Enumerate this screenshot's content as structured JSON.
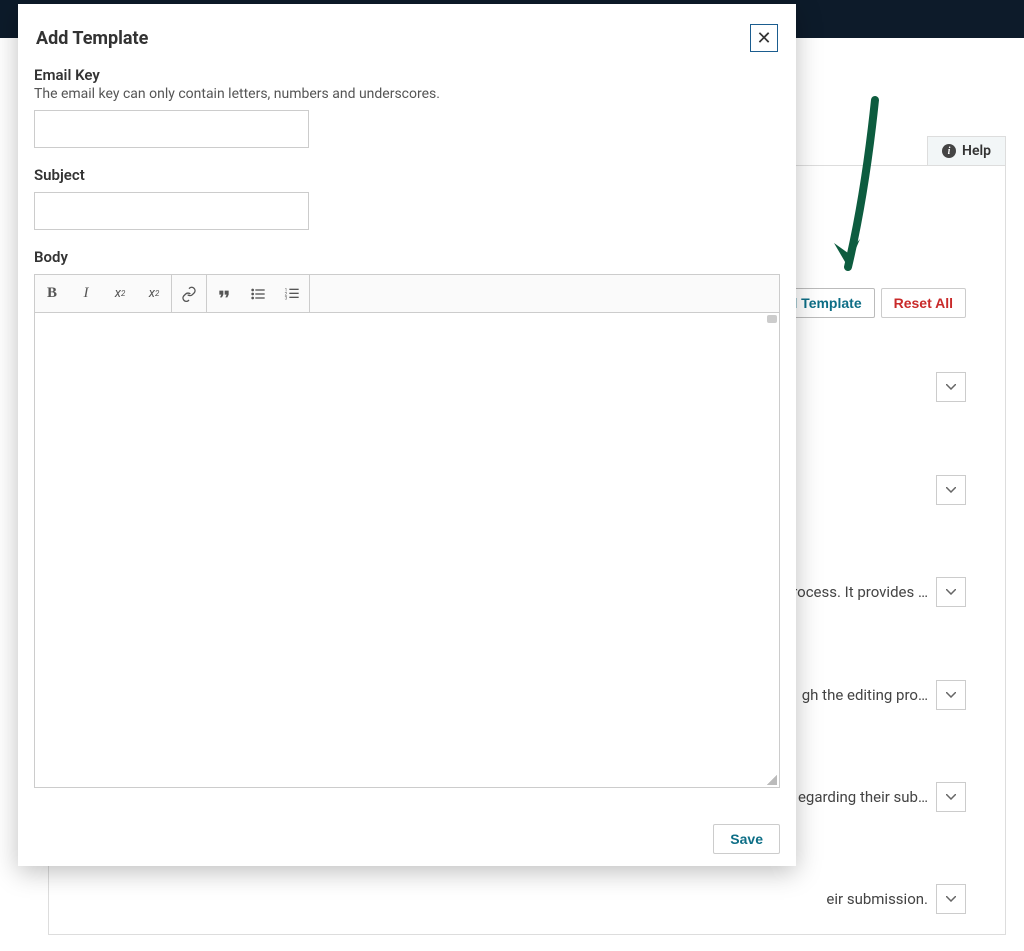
{
  "header": {},
  "help": {
    "label": "Help"
  },
  "buttons": {
    "add_template": "Add Template",
    "reset_all": "Reset All"
  },
  "rows": [
    {
      "text": ""
    },
    {
      "text": ""
    },
    {
      "text": "rocess. It provides …"
    },
    {
      "text": "gh the editing pro…"
    },
    {
      "text": "egarding their sub…"
    },
    {
      "text": "eir submission."
    }
  ],
  "modal": {
    "title": "Add Template",
    "fields": {
      "email_key": {
        "label": "Email Key",
        "hint": "The email key can only contain letters, numbers and underscores.",
        "value": ""
      },
      "subject": {
        "label": "Subject",
        "value": ""
      },
      "body": {
        "label": "Body",
        "value": ""
      }
    },
    "toolbar": {
      "bold": "B",
      "italic": "I",
      "sup_label": "x",
      "sub_label": "x"
    },
    "save": "Save"
  }
}
